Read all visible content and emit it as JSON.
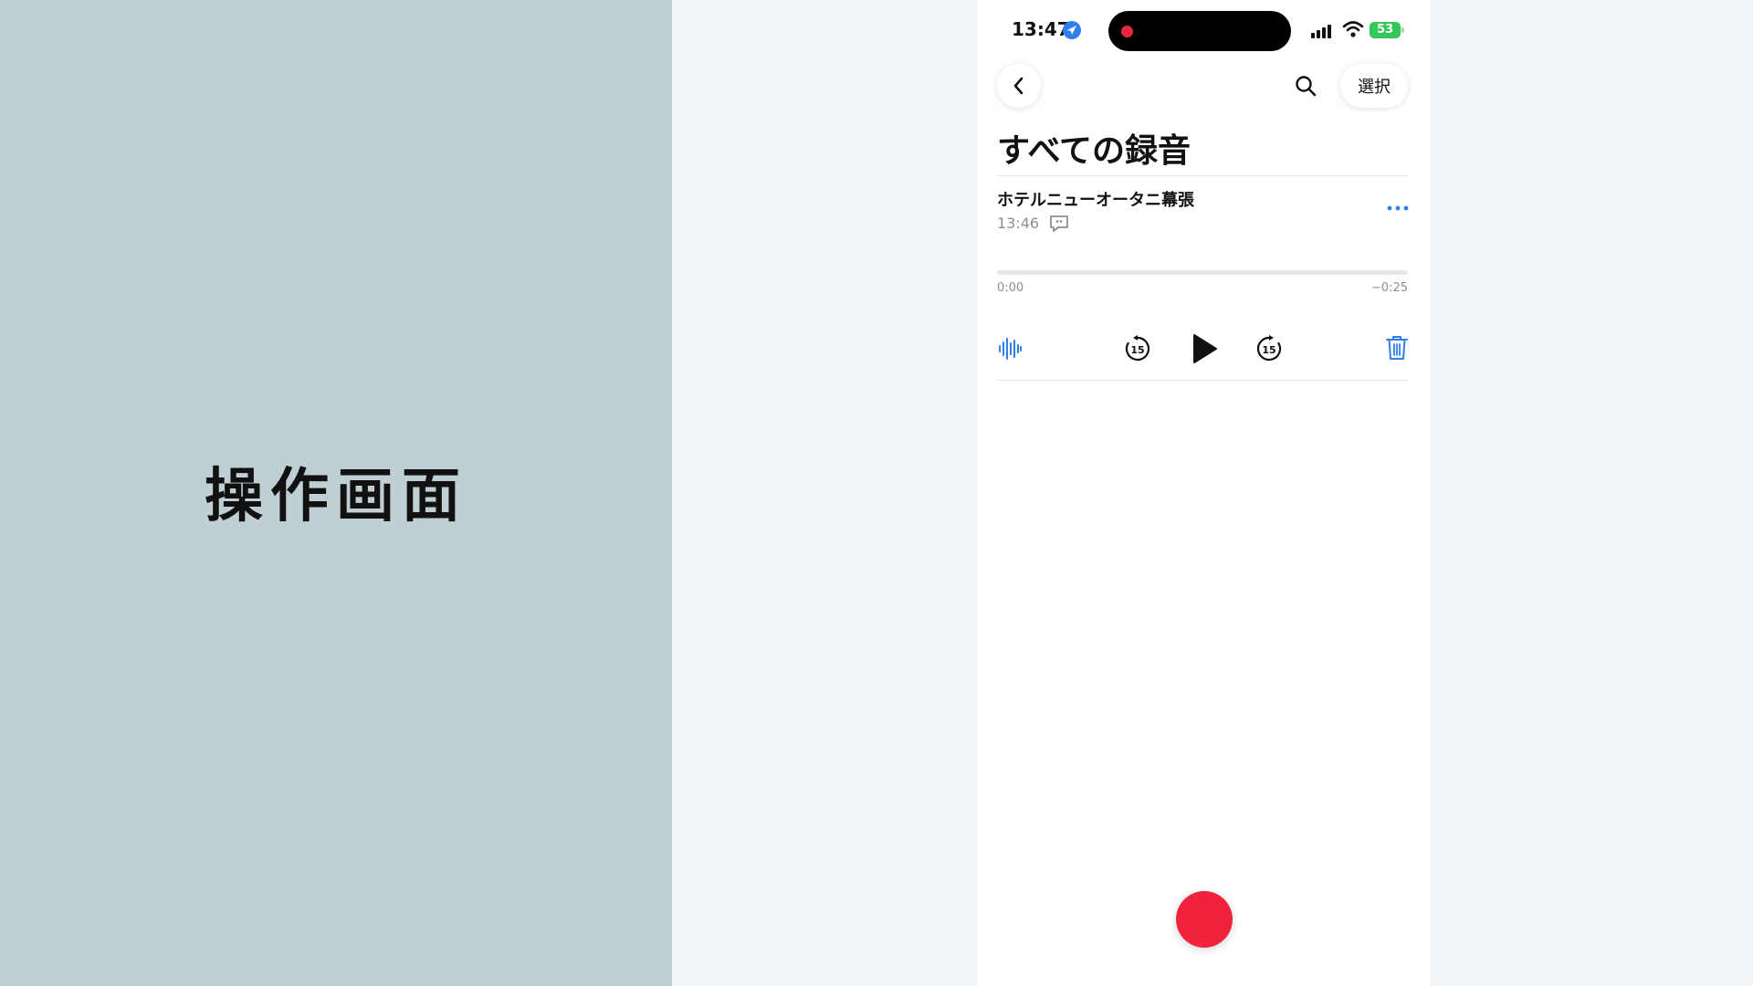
{
  "slide": {
    "title": "操作画面"
  },
  "status_bar": {
    "time": "13:47",
    "battery_level": "53"
  },
  "nav": {
    "select_label": "選択"
  },
  "page": {
    "title": "すべての録音"
  },
  "recording": {
    "name": "ホテルニューオータニ幕張",
    "time": "13:46",
    "elapsed": "0:00",
    "remaining": "−0:25",
    "progress": 0
  },
  "icons": {
    "location": "location-arrow-icon",
    "signal": "cellular-signal-icon",
    "wifi": "wifi-icon",
    "battery": "battery-charging-icon",
    "back": "chevron-left-icon",
    "search": "search-icon",
    "transcript": "transcript-bubble-icon",
    "more": "ellipsis-icon",
    "waveform": "waveform-icon",
    "skip_back": "skip-back-15-icon",
    "play": "play-icon",
    "skip_forward": "skip-forward-15-icon",
    "trash": "trash-icon",
    "record": "record-icon"
  },
  "colors": {
    "accent": "#2f80ed",
    "record": "#ef233c",
    "battery": "#34c759",
    "left_panel": "#bfcfd4"
  }
}
